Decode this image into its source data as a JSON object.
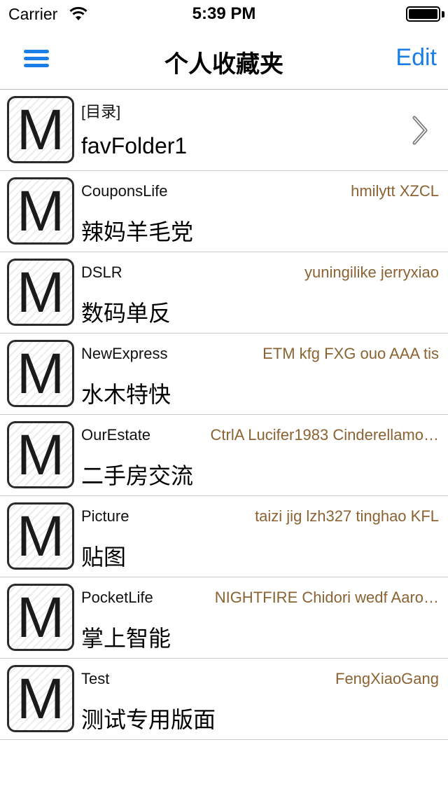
{
  "status_bar": {
    "carrier": "Carrier",
    "time": "5:39 PM"
  },
  "nav": {
    "title": "个人收藏夹",
    "edit_label": "Edit",
    "menu_icon": "hamburger-menu-icon",
    "accent_color": "#1a7ee6"
  },
  "folder": {
    "label": "[目录]",
    "name": "favFolder1",
    "icon_letter": "M"
  },
  "boards": [
    {
      "name": "CouponsLife",
      "desc": "辣妈羊毛党",
      "moderators": "hmilytt XZCL",
      "icon_letter": "M"
    },
    {
      "name": "DSLR",
      "desc": "数码单反",
      "moderators": "yuningilike jerryxiao",
      "icon_letter": "M"
    },
    {
      "name": "NewExpress",
      "desc": "水木特快",
      "moderators": "ETM kfg FXG ouo AAA tis",
      "icon_letter": "M"
    },
    {
      "name": "OurEstate",
      "desc": "二手房交流",
      "moderators": "CtrlA Lucifer1983 Cinderellamo…",
      "icon_letter": "M"
    },
    {
      "name": "Picture",
      "desc": "贴图",
      "moderators": "taizi jig lzh327 tinghao KFL",
      "icon_letter": "M"
    },
    {
      "name": "PocketLife",
      "desc": "掌上智能",
      "moderators": "NIGHTFIRE Chidori wedf Aaro…",
      "icon_letter": "M"
    },
    {
      "name": "Test",
      "desc": "测试专用版面",
      "moderators": "FengXiaoGang",
      "icon_letter": "M"
    }
  ],
  "colors": {
    "moderator_text": "#8b6333",
    "separator": "#c8c7cc"
  }
}
